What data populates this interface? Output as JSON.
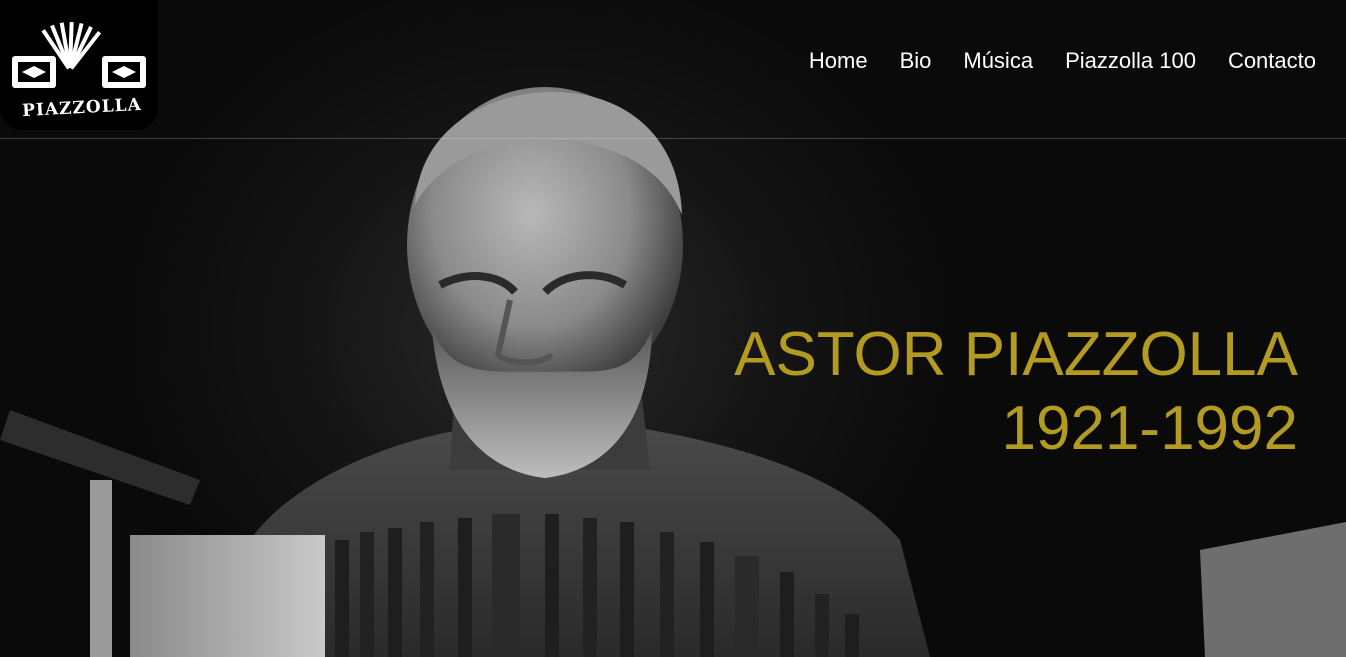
{
  "brand": {
    "logo_text": "PIAZZOLLA"
  },
  "nav": {
    "items": [
      {
        "label": "Home"
      },
      {
        "label": "Bio"
      },
      {
        "label": "Música"
      },
      {
        "label": "Piazzolla 100"
      },
      {
        "label": "Contacto"
      }
    ]
  },
  "hero": {
    "name": "ASTOR PIAZZOLLA",
    "years": "1921-1992"
  },
  "colors": {
    "accent": "#b39b21",
    "background": "#0b0b0b",
    "nav_text": "#ffffff"
  },
  "icons": {
    "logo": "bandoneon-icon"
  }
}
